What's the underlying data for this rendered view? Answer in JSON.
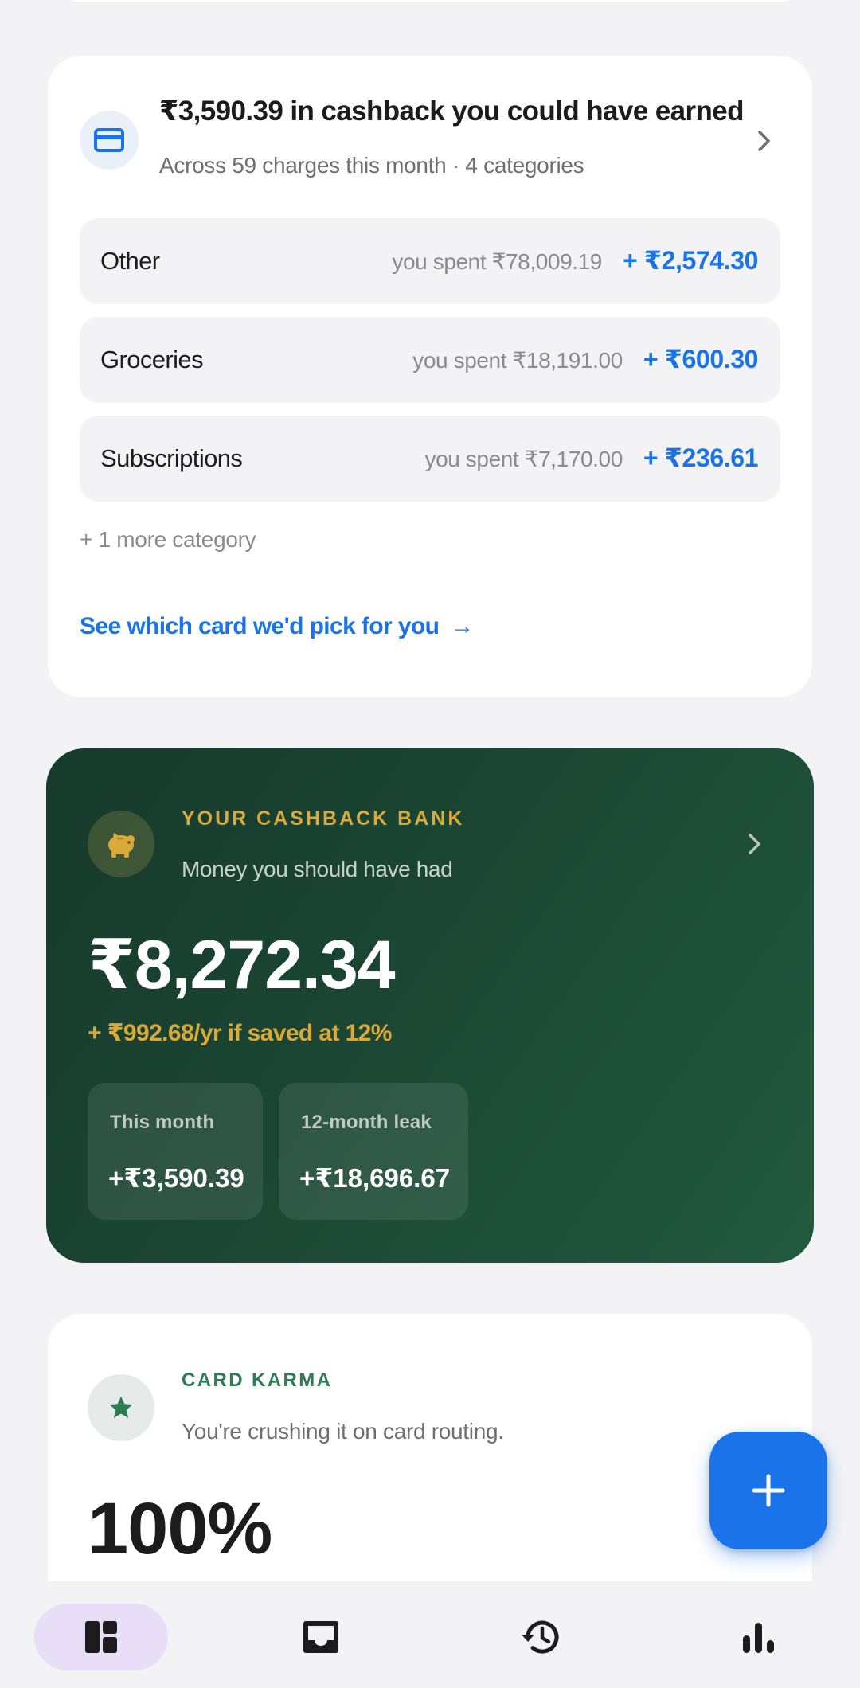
{
  "cashback_card": {
    "title": "₹3,590.39 in cashback you could have earned",
    "subtitle": "Across 59 charges this month · 4 categories",
    "categories": [
      {
        "name": "Other",
        "spent": "you spent ₹78,009.19",
        "gain": "+ ₹2,574.30"
      },
      {
        "name": "Groceries",
        "spent": "you spent ₹18,191.00",
        "gain": "+ ₹600.30"
      },
      {
        "name": "Subscriptions",
        "spent": "you spent ₹7,170.00",
        "gain": "+ ₹236.61"
      }
    ],
    "more_categories": "+ 1 more category",
    "link_label": "See which card we'd pick for you",
    "link_arrow": "→",
    "icon": "credit-card-icon"
  },
  "cashback_bank": {
    "eyebrow": "YOUR CASHBACK BANK",
    "subtitle": "Money you should have had",
    "amount": "₹8,272.34",
    "yield_text": "+ ₹992.68/yr if saved at 12%",
    "stats": [
      {
        "label": "This month",
        "value": "+₹3,590.39"
      },
      {
        "label": "12-month leak",
        "value": "+₹18,696.67"
      }
    ],
    "icon": "piggy-bank-icon"
  },
  "card_karma": {
    "eyebrow": "CARD KARMA",
    "subtitle": "You're crushing it on card routing.",
    "value": "100%",
    "icon": "star-icon"
  },
  "fab": {
    "icon": "plus-icon"
  },
  "bottom_nav": {
    "items": [
      {
        "icon": "dashboard-icon",
        "active": true
      },
      {
        "icon": "inbox-icon",
        "active": false
      },
      {
        "icon": "history-icon",
        "active": false
      },
      {
        "icon": "bar-chart-icon",
        "active": false
      }
    ]
  },
  "colors": {
    "accent_blue": "#1a73e8",
    "bank_green": "#1b4633",
    "bank_gold": "#d9a93a",
    "karma_green": "#2f7d55",
    "nav_active": "#e8def8"
  }
}
